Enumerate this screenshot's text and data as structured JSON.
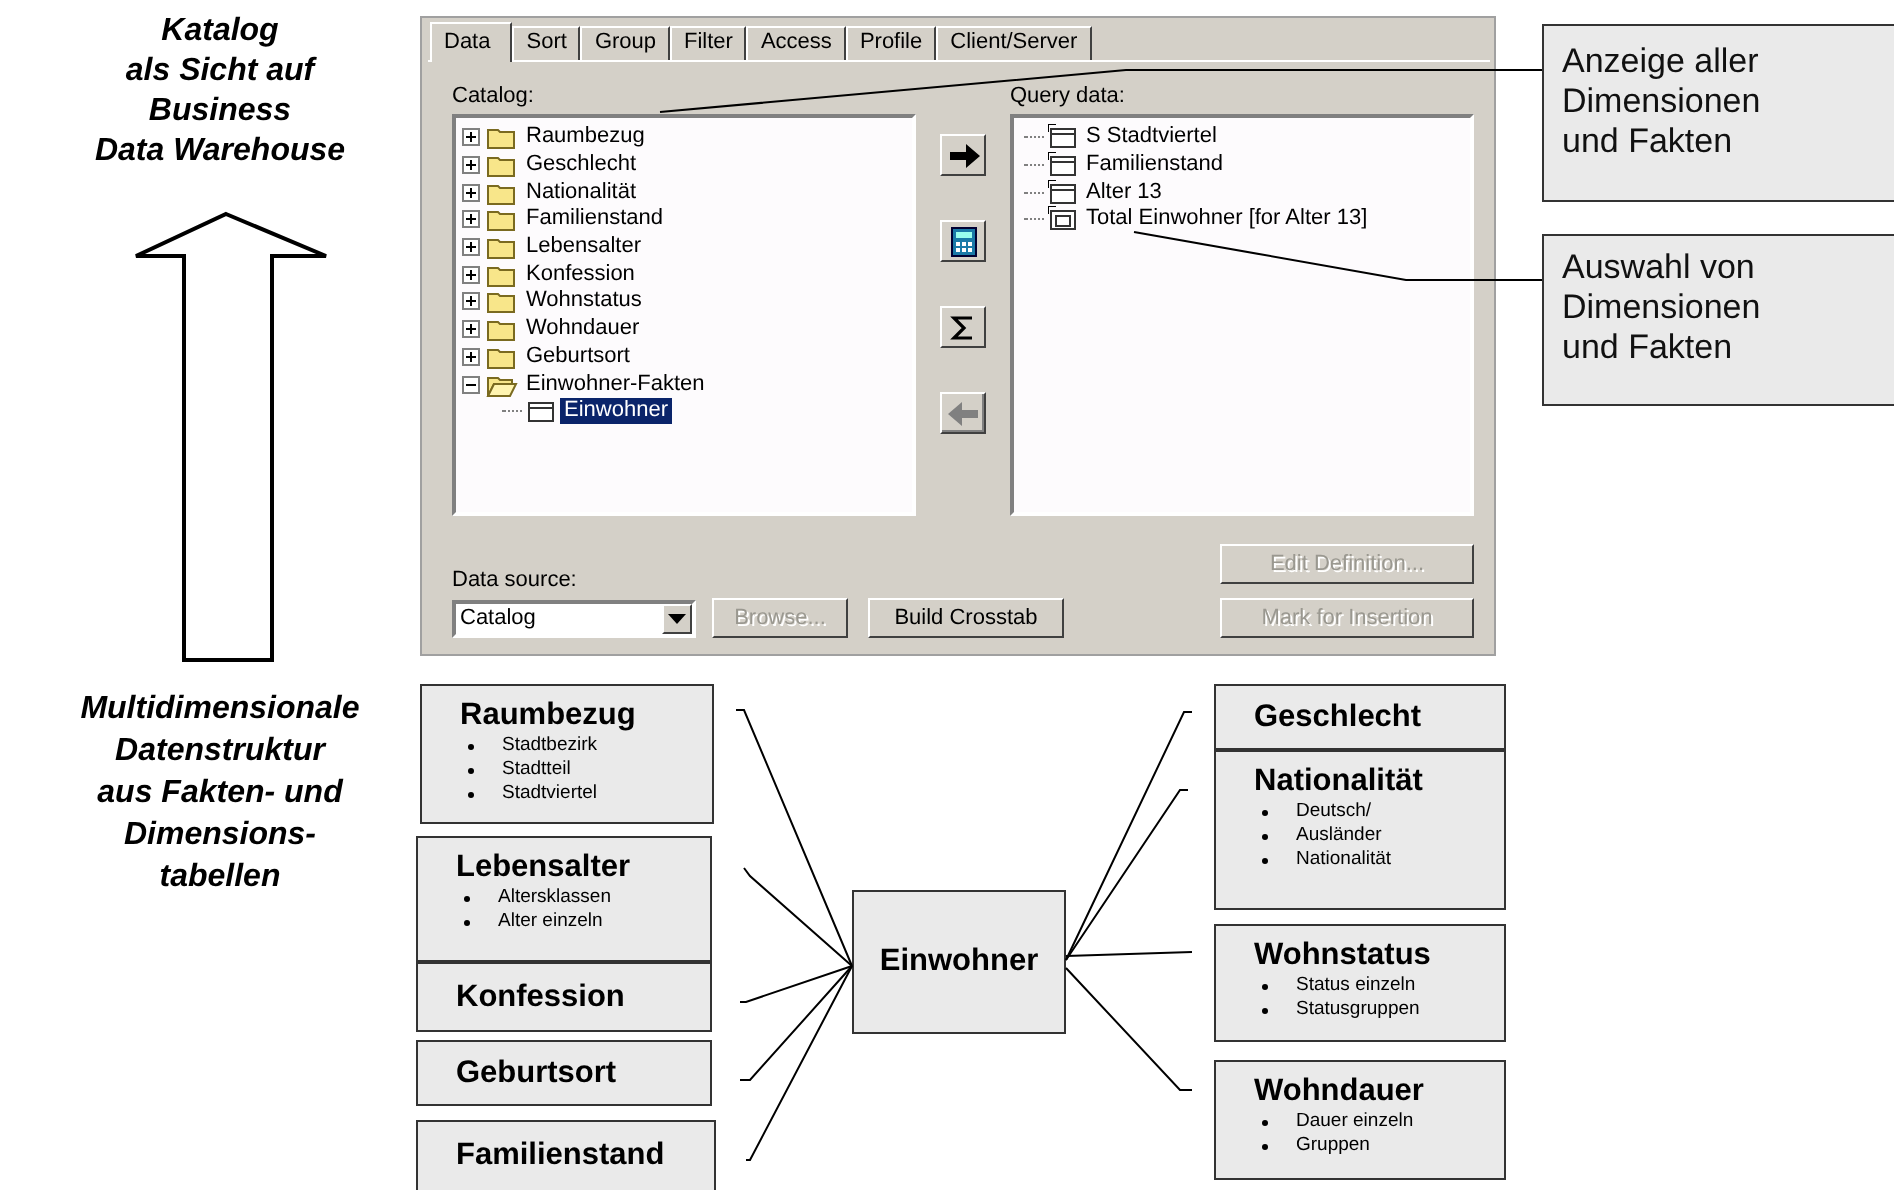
{
  "side_labels": [
    {
      "text": "Katalog\nals Sicht auf\nBusiness\nData Warehouse"
    },
    {
      "text": "Multidimensionale\nDatenstruktur\naus Fakten- und\nDimensions-\ntabellen"
    }
  ],
  "dialog": {
    "tabs": [
      {
        "label": "Data",
        "selected": true
      },
      {
        "label": "Sort",
        "selected": false
      },
      {
        "label": "Group",
        "selected": false
      },
      {
        "label": "Filter",
        "selected": false
      },
      {
        "label": "Access",
        "selected": false
      },
      {
        "label": "Profile",
        "selected": false
      },
      {
        "label": "Client/Server",
        "selected": false
      }
    ],
    "catalog": {
      "label": "Catalog:",
      "items": [
        {
          "label": "Raumbezug",
          "expanded": false,
          "selected": false
        },
        {
          "label": "Geschlecht",
          "expanded": false,
          "selected": false
        },
        {
          "label": "Nationalität",
          "expanded": false,
          "selected": false
        },
        {
          "label": "Familienstand",
          "expanded": false,
          "selected": false
        },
        {
          "label": "Lebensalter",
          "expanded": false,
          "selected": false
        },
        {
          "label": "Konfession",
          "expanded": false,
          "selected": false
        },
        {
          "label": "Wohnstatus",
          "expanded": false,
          "selected": false
        },
        {
          "label": "Wohndauer",
          "expanded": false,
          "selected": false
        },
        {
          "label": "Geburtsort",
          "expanded": false,
          "selected": false
        },
        {
          "label": "Einwohner-Fakten",
          "expanded": true,
          "selected": false,
          "children": [
            {
              "label": "Einwohner",
              "selected": true
            }
          ]
        }
      ]
    },
    "tool_buttons": [
      {
        "kind": "add",
        "disabled": false
      },
      {
        "kind": "calculate",
        "disabled": false
      },
      {
        "kind": "sum",
        "disabled": false
      },
      {
        "kind": "remove",
        "disabled": true
      }
    ],
    "query": {
      "label": "Query data:",
      "items": [
        {
          "label": "S Stadtviertel",
          "kind": "dimension"
        },
        {
          "label": "Familienstand",
          "kind": "dimension"
        },
        {
          "label": "Alter 13",
          "kind": "dimension"
        },
        {
          "label": "Total Einwohner [for Alter 13]",
          "kind": "measure"
        }
      ]
    },
    "data_source": {
      "label": "Data source:",
      "value": "Catalog"
    },
    "buttons": [
      {
        "label": "Browse...",
        "disabled": true
      },
      {
        "label": "Build Crosstab",
        "disabled": false
      }
    ],
    "side_buttons": [
      {
        "label": "Edit Definition...",
        "disabled": true
      },
      {
        "label": "Mark for Insertion",
        "disabled": true
      }
    ]
  },
  "callouts": [
    {
      "text": "Anzeige aller\nDimensionen\nund Fakten"
    },
    {
      "text": "Auswahl von\nDimensionen\nund Fakten"
    }
  ],
  "diagram": {
    "center": "Einwohner",
    "left": [
      {
        "title": "Raumbezug",
        "items": [
          "Stadtbezirk",
          "Stadtteil",
          "Stadtviertel"
        ]
      },
      {
        "title": "Lebensalter",
        "items": [
          "Altersklassen",
          "Alter einzeln"
        ]
      },
      {
        "title": "Konfession"
      },
      {
        "title": "Geburtsort"
      },
      {
        "title": "Familienstand"
      }
    ],
    "right": [
      {
        "title": "Geschlecht"
      },
      {
        "title": "Nationalität",
        "items": [
          "Deutsch/",
          "Ausländer",
          "Nationalität"
        ]
      },
      {
        "title": "Wohnstatus",
        "items": [
          "Status einzeln",
          "Statusgruppen"
        ]
      },
      {
        "title": "Wohndauer",
        "items": [
          "Dauer einzeln",
          "Gruppen"
        ]
      }
    ]
  }
}
